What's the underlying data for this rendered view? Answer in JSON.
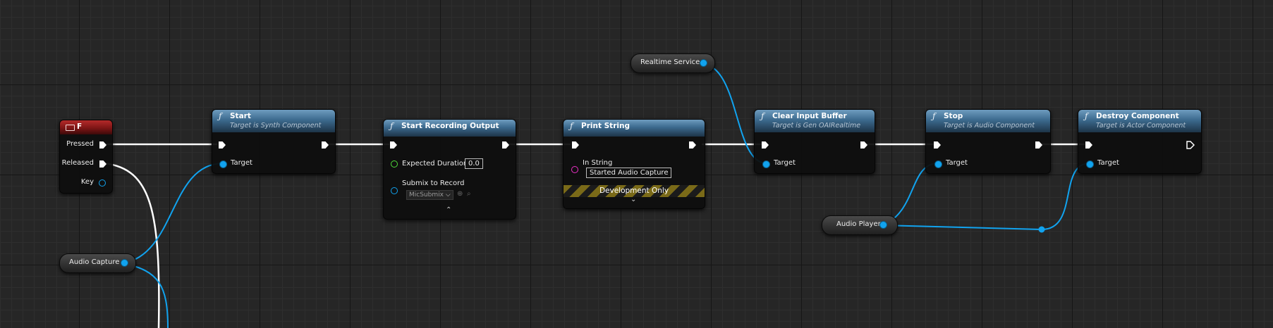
{
  "nodes": {
    "input_f": {
      "title": "F",
      "pins": {
        "pressed": "Pressed",
        "released": "Released",
        "key": "Key"
      }
    },
    "start": {
      "title": "Start",
      "subtitle": "Target is Synth Component",
      "pins": {
        "target": "Target"
      }
    },
    "start_recording": {
      "title": "Start Recording Output",
      "pins": {
        "expected_duration": "Expected Duration",
        "submix": "Submix to Record"
      },
      "expected_duration_value": "0.0",
      "submix_value": "MicSubmix"
    },
    "print_string": {
      "title": "Print String",
      "pins": {
        "in_string": "In String"
      },
      "in_string_value": "Started Audio Capture",
      "dev_only": "Development Only"
    },
    "clear_input_buffer": {
      "title": "Clear Input Buffer",
      "subtitle": "Target is Gen OAIRealtime",
      "pins": {
        "target": "Target"
      }
    },
    "stop": {
      "title": "Stop",
      "subtitle": "Target is Audio Component",
      "pins": {
        "target": "Target"
      }
    },
    "destroy_component": {
      "title": "Destroy Component",
      "subtitle": "Target is Actor Component",
      "pins": {
        "target": "Target"
      }
    }
  },
  "variables": {
    "realtime_service": "Realtime Service",
    "audio_capture": "Audio Capture",
    "audio_player": "Audio Player"
  },
  "colors": {
    "exec": "#ffffff",
    "object": "#11a3ef",
    "float": "#4fdd3a",
    "string": "#ee2fc8",
    "function_header": "#3c6a8e",
    "event_header": "#b52a2a"
  }
}
